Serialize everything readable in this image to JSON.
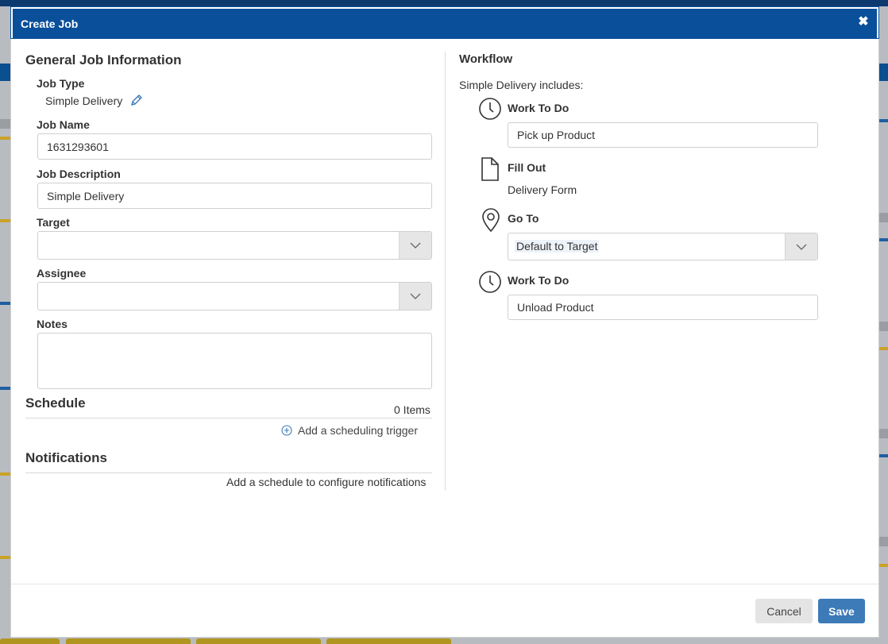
{
  "dialog": {
    "title": "Create Job",
    "close_glyph": "✖"
  },
  "general": {
    "heading": "General Job Information",
    "job_type": {
      "label": "Job Type",
      "value": "Simple Delivery"
    },
    "job_name": {
      "label": "Job Name",
      "value": "1631293601"
    },
    "job_description": {
      "label": "Job Description",
      "value": "Simple Delivery"
    },
    "target": {
      "label": "Target",
      "value": ""
    },
    "assignee": {
      "label": "Assignee",
      "value": ""
    },
    "notes": {
      "label": "Notes",
      "value": ""
    }
  },
  "schedule": {
    "heading": "Schedule",
    "count": "0 Items",
    "add_trigger": "Add a scheduling trigger"
  },
  "notifications": {
    "heading": "Notifications",
    "hint": "Add a schedule to configure notifications"
  },
  "workflow": {
    "heading": "Workflow",
    "intro": "Simple Delivery includes:",
    "steps": [
      {
        "icon": "clock-icon",
        "title": "Work To Do",
        "value": "Pick up Product"
      },
      {
        "icon": "document-icon",
        "title": "Fill Out",
        "value": "Delivery Form"
      },
      {
        "icon": "map-pin-icon",
        "title": "Go To",
        "value": "Default to Target"
      },
      {
        "icon": "clock-icon",
        "title": "Work To Do",
        "value": "Unload Product"
      }
    ]
  },
  "footer": {
    "cancel_label": "Cancel",
    "save_label": "Save"
  },
  "colors": {
    "header": "#0a4f9a",
    "save_button": "#3d7ab8",
    "edit_icon": "#3d7ab8"
  }
}
